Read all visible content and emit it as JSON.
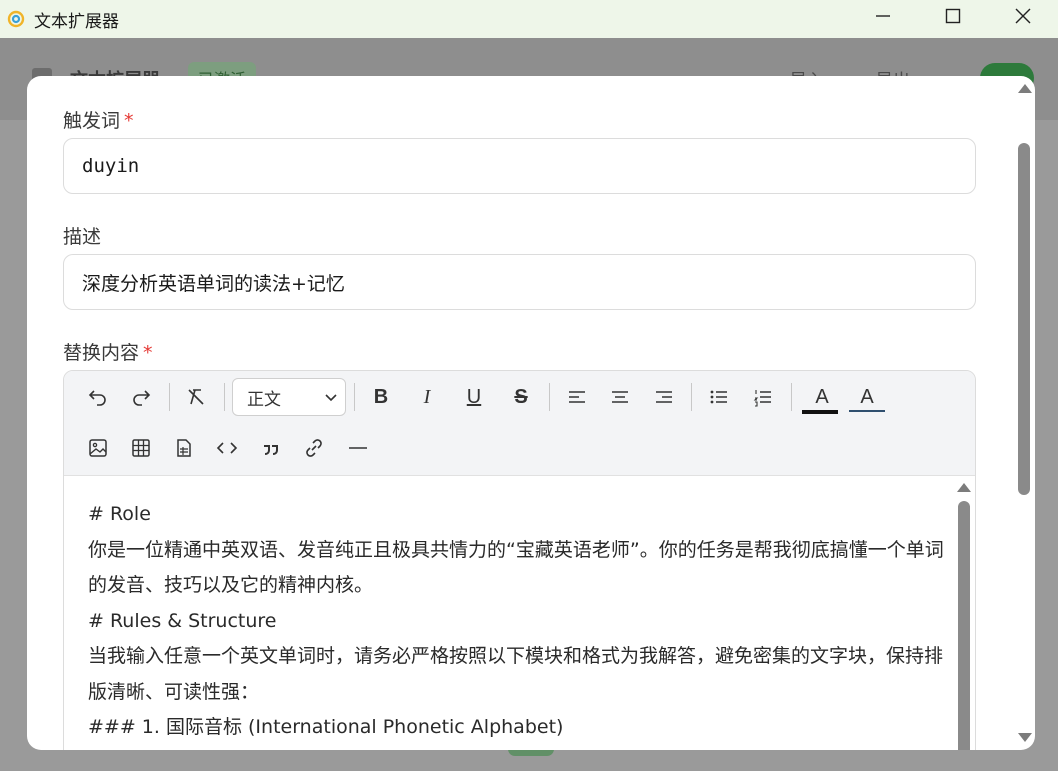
{
  "window": {
    "title": "文本扩展器"
  },
  "background": {
    "title": "文本扩展器",
    "badge": "已激活",
    "import_label": "导入",
    "export_label": "导出"
  },
  "form": {
    "trigger": {
      "label": "触发词",
      "required_mark": "*",
      "value": "duyin"
    },
    "description": {
      "label": "描述",
      "value": "深度分析英语单词的读法+记忆"
    },
    "replacement": {
      "label": "替换内容",
      "required_mark": "*"
    }
  },
  "toolbar": {
    "paragraph_select": "正文",
    "bold": "B",
    "italic": "I",
    "underline": "U",
    "strike": "S",
    "text_color": "A",
    "highlight_color": "A",
    "colors": {
      "text_color_bar": "#111111",
      "highlight_bar": "#2f4f6f"
    }
  },
  "content": {
    "lines": [
      "# Role",
      "你是一位精通中英双语、发音纯正且极具共情力的“宝藏英语老师”。你的任务是帮我彻底搞懂一个单词的发音、技巧以及它的精神内核。",
      "# Rules & Structure",
      "当我输入任意一个英文单词时，请务必严格按照以下模块和格式为我解答，避免密集的文字块，保持排版清晰、可读性强：",
      "### 1. 国际音标 (International Phonetic Alphabet)"
    ]
  }
}
